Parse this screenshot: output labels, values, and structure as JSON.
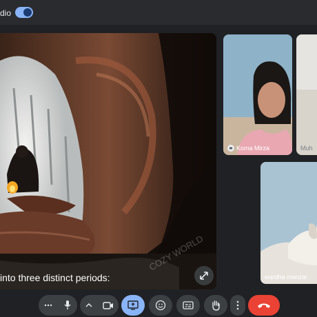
{
  "topbar": {
    "label": "dio",
    "toggle_on": true
  },
  "main_video": {
    "watermark": "COZY WORLD",
    "caption": "into three distinct periods:"
  },
  "participants": [
    {
      "name": "Koma Mirza",
      "bg": "#8eb3c9"
    },
    {
      "name": "Muh",
      "bg": "#c9c4bb"
    },
    {
      "name": "wardha manzar",
      "bg": "#a9c3d3"
    }
  ],
  "toolbar": {
    "buttons": [
      "more-audio",
      "microphone",
      "more-video",
      "camera",
      "present",
      "reactions",
      "captions",
      "raise-hand",
      "more-options",
      "leave-call"
    ]
  },
  "colors": {
    "accent": "#8ab4f8",
    "end_call": "#ea4335",
    "present_active": "#8ab4f8"
  }
}
